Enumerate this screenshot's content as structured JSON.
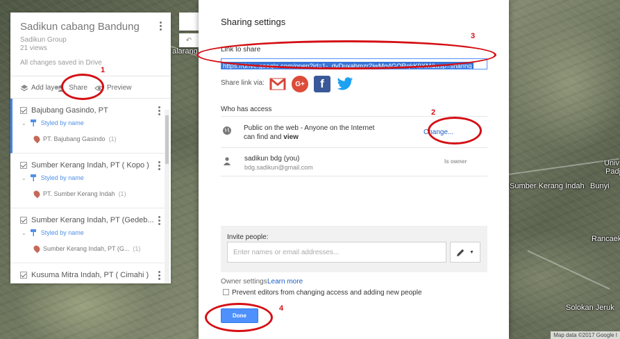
{
  "map": {
    "labels": [
      "alarang",
      "Sumber Kerang Indah",
      "Bunyi",
      "Univ",
      "Padj",
      "Rancaeke",
      "Solokan Jeruk"
    ],
    "attribution": "Map data ©2017 Google I"
  },
  "left_panel": {
    "title": "Sadikun cabang Bandung",
    "owner": "Sadikun Group",
    "views": "21 views",
    "status": "All changes saved in Drive",
    "actions": {
      "add_layer": "Add layer",
      "share": "Share",
      "preview": "Preview"
    },
    "layers": [
      {
        "name": "Bajubang Gasindo, PT",
        "style": "Styled by name",
        "item": "PT. Bajubang Gasindo",
        "count": "(1)"
      },
      {
        "name": "Sumber Kerang Indah, PT ( Kopo )",
        "style": "Styled by name",
        "item": "PT. Sumber Kerang Indah",
        "count": "(1)"
      },
      {
        "name": "Sumber Kerang Indah, PT (Gedeb...",
        "style": "Styled by name",
        "item": "Sumber Kerang Indah, PT (G...",
        "count": "(1)"
      },
      {
        "name": "Kusuma Mitra Indah, PT ( Cimahi )",
        "style": "",
        "item": "",
        "count": ""
      }
    ]
  },
  "dialog": {
    "title": "Sharing settings",
    "link_label": "Link to share",
    "link_value": "https://drive.google.com/open?id=1-_dvDuxabmzr2jwMg4GORqkK9XM&usp=sharing",
    "share_via_label": "Share link via:",
    "who_has_access_label": "Who has access",
    "access": {
      "public_line1": "Public on the web - Anyone on the Internet",
      "public_line2_prefix": "can find and ",
      "public_line2_bold": "view",
      "change_link": "Change...",
      "owner_name": "sadikun bdg (you)",
      "owner_email": "bdg.sadikun@gmail.com",
      "owner_role": "Is owner"
    },
    "invite_label": "Invite people:",
    "invite_placeholder": "Enter names or email addresses...",
    "owner_settings_label": "Owner settings",
    "learn_more": "Learn more",
    "prevent_label": "Prevent editors from changing access and adding new people",
    "done_label": "Done"
  },
  "annotations": [
    "1",
    "2",
    "3",
    "4"
  ],
  "colors": {
    "annotation_red": "#d40f14",
    "link_blue": "#1a5fc4",
    "done_blue": "#4d90fe",
    "gmail_red": "#d44638",
    "gplus_red": "#dd4b39",
    "facebook_blue": "#3b5998",
    "twitter_blue": "#1da1f2"
  }
}
